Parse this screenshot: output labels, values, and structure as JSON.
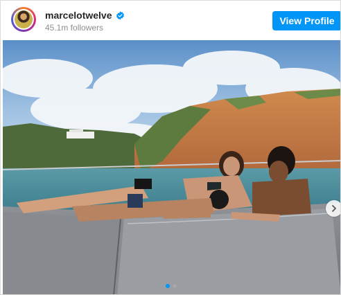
{
  "post_header": {
    "username": "marcelotwelve",
    "followers": "45.1m followers",
    "verified_icon": "verified-badge-icon",
    "view_profile_label": "View Profile"
  },
  "carousel": {
    "next_icon": "chevron-right-icon",
    "slide_count": 2,
    "active_slide": 1
  },
  "colors": {
    "accent": "#0095f6",
    "username": "#262626",
    "muted": "#8e8e8e"
  }
}
